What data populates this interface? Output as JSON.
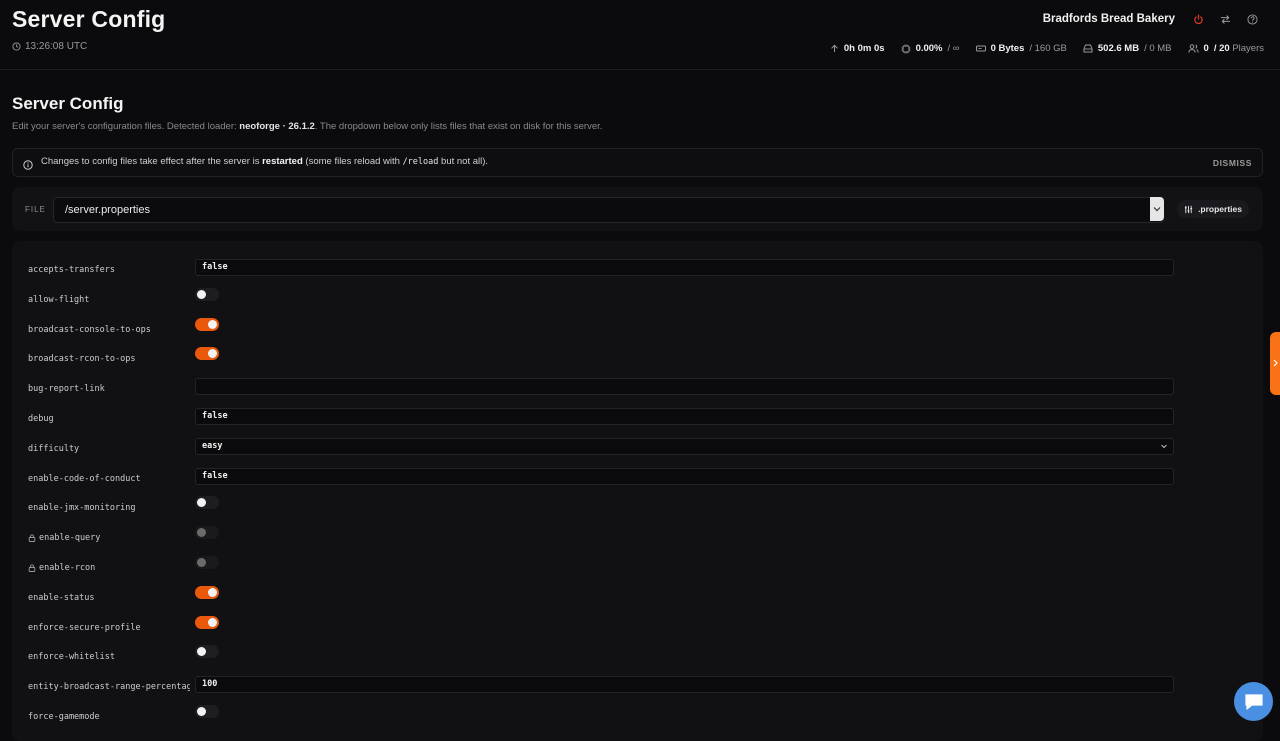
{
  "header": {
    "title": "Server Config",
    "clock": "13:26:08 UTC",
    "server_name": "Bradfords Bread Bakery",
    "stats": {
      "uptime": "0h 0m 0s",
      "cpu_value": "0.00%",
      "cpu_limit": "/ ∞",
      "disk_value": "0 Bytes",
      "disk_limit": "/ 160 GB",
      "memory_value": "502.6 MB",
      "memory_limit": "/ 0 MB",
      "players_online": "0",
      "players_max": "/ 20",
      "players_label": "Players"
    }
  },
  "page": {
    "heading": "Server Config",
    "subtitle_prefix": "Edit your server's configuration files. Detected loader: ",
    "loader": "neoforge · 26.1.2",
    "subtitle_suffix": ". The dropdown below only lists files that exist on disk for this server."
  },
  "notice": {
    "text_prefix": "Changes to config files take effect after the server is ",
    "text_bold": "restarted",
    "text_middle": " (some files reload with ",
    "text_code": "/reload",
    "text_suffix": " but not all).",
    "dismiss_label": "DISMISS"
  },
  "file_selector": {
    "label": "FILE",
    "value": "/server.properties",
    "extension_badge": ".properties"
  },
  "properties": [
    {
      "key": "accepts-transfers",
      "type": "text",
      "value": "false"
    },
    {
      "key": "allow-flight",
      "type": "toggle",
      "on": false
    },
    {
      "key": "broadcast-console-to-ops",
      "type": "toggle",
      "on": true
    },
    {
      "key": "broadcast-rcon-to-ops",
      "type": "toggle",
      "on": true
    },
    {
      "key": "bug-report-link",
      "type": "text",
      "value": ""
    },
    {
      "key": "debug",
      "type": "text",
      "value": "false"
    },
    {
      "key": "difficulty",
      "type": "select",
      "value": "easy"
    },
    {
      "key": "enable-code-of-conduct",
      "type": "text",
      "value": "false"
    },
    {
      "key": "enable-jmx-monitoring",
      "type": "toggle",
      "on": false
    },
    {
      "key": "enable-query",
      "type": "toggle",
      "on": false,
      "locked": true
    },
    {
      "key": "enable-rcon",
      "type": "toggle",
      "on": false,
      "locked": true
    },
    {
      "key": "enable-status",
      "type": "toggle",
      "on": true
    },
    {
      "key": "enforce-secure-profile",
      "type": "toggle",
      "on": true
    },
    {
      "key": "enforce-whitelist",
      "type": "toggle",
      "on": false
    },
    {
      "key": "entity-broadcast-range-percentage",
      "type": "text",
      "value": "100"
    },
    {
      "key": "force-gamemode",
      "type": "toggle",
      "on": false
    }
  ],
  "colors": {
    "accent": "#ea580c",
    "background": "#0b0b0d",
    "panel": "#111114",
    "chat": "#4a90e2"
  }
}
